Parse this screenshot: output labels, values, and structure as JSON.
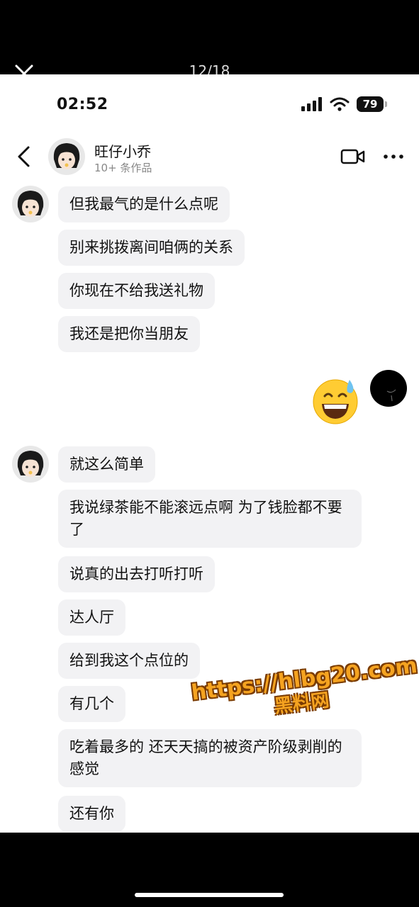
{
  "viewer": {
    "page_counter": "12/18"
  },
  "status_bar": {
    "time": "02:52",
    "battery": "79"
  },
  "header": {
    "name": "旺仔小乔",
    "subtitle": "10+ 条作品"
  },
  "messages_group1": [
    "但我最气的是什么点呢",
    "别来挑拨离间咱俩的关系",
    "你现在不给我送礼物",
    "我还是把你当朋友"
  ],
  "self_message": {
    "emoji": "😅"
  },
  "messages_group2": [
    "就这么简单",
    "我说绿茶能不能滚远点啊 为了钱脸都不要了",
    "说真的出去打听打听",
    "达人厅",
    "给到我这个点位的",
    "有几个",
    "吃着最多的 还天天搞的被资产阶级剥削的感觉",
    "还有你"
  ],
  "watermark": {
    "url": "https://hlbg20.com",
    "name": "黑料网"
  },
  "colors": {
    "bubble": "#f2f2f4",
    "background": "#ffffff",
    "watermark": "#f5a320"
  }
}
